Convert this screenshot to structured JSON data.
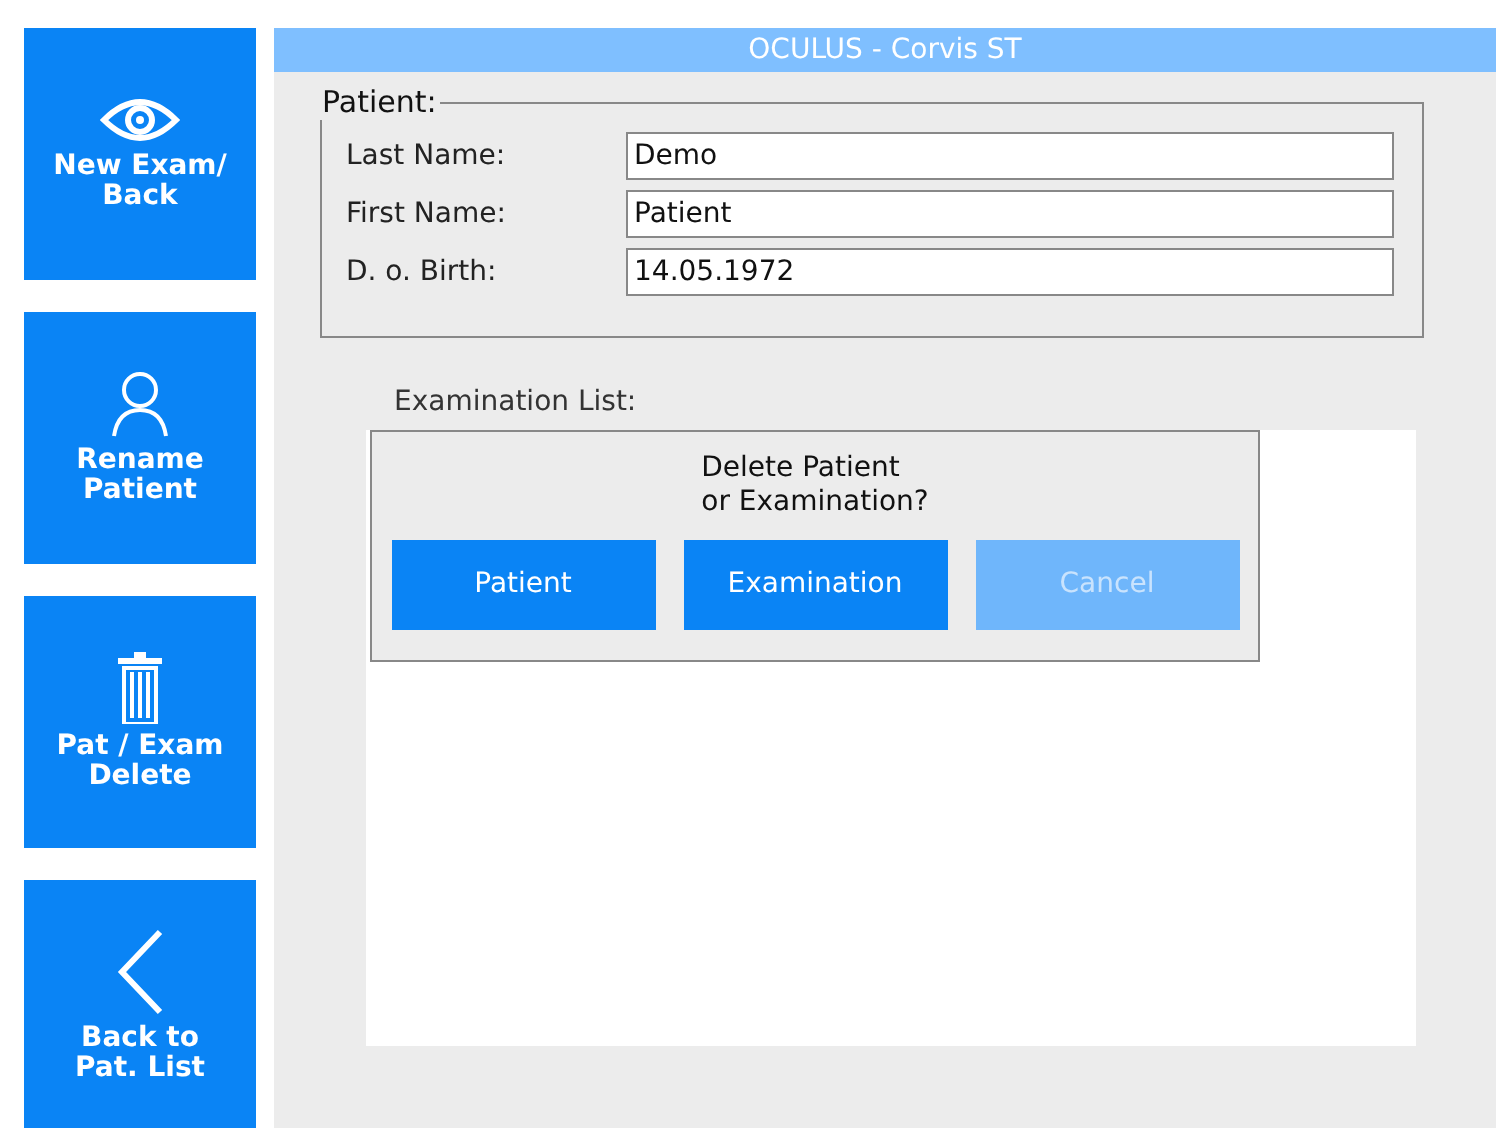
{
  "window": {
    "title": "OCULUS - Corvis ST"
  },
  "sidebar": {
    "buttons": [
      {
        "kind": "eye",
        "label": "New Exam/\nBack"
      },
      {
        "kind": "person",
        "label": "Rename\nPatient"
      },
      {
        "kind": "trash",
        "label": "Pat / Exam\nDelete"
      },
      {
        "kind": "back",
        "label": "Back to\nPat. List"
      }
    ]
  },
  "patient": {
    "legend": "Patient:",
    "fields": [
      {
        "label": "Last Name:",
        "value": "Demo"
      },
      {
        "label": "First Name:",
        "value": "Patient"
      },
      {
        "label": "D. o. Birth:",
        "value": "14.05.1972"
      }
    ]
  },
  "examination_list": {
    "label": "Examination List:"
  },
  "dialog": {
    "message": "Delete Patient\nor Examination?",
    "buttons": [
      {
        "label": "Patient",
        "disabled": false
      },
      {
        "label": "Examination",
        "disabled": false
      },
      {
        "label": "Cancel",
        "disabled": true
      }
    ]
  }
}
